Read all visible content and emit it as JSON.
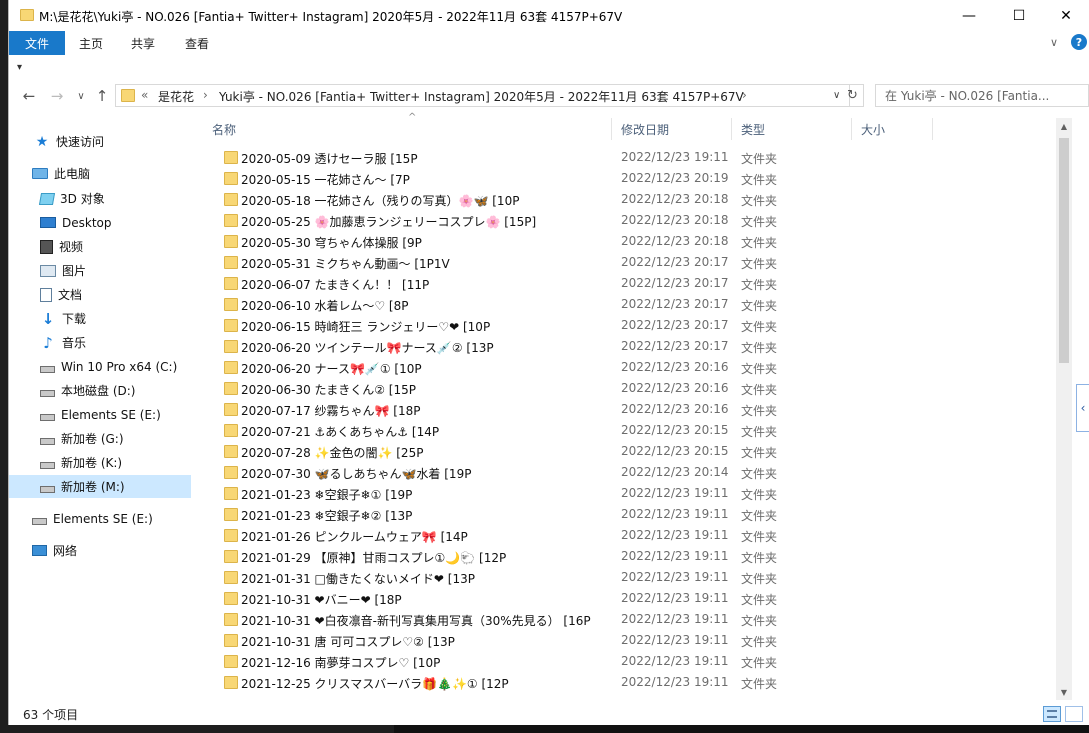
{
  "window": {
    "title": "M:\\是花花\\Yuki亭 - NO.026 [Fantia+ Twitter+ Instagram]  2020年5月 - 2022年11月 63套  4157P+67V",
    "minimize": "—",
    "maximize": "☐",
    "close": "✕"
  },
  "ribbon": {
    "file": "文件",
    "tabs": [
      "主页",
      "共享",
      "查看"
    ],
    "expand": "∨",
    "help": "?"
  },
  "qat": {
    "dropdown": "▾"
  },
  "nav": {
    "back": "←",
    "forward": "→",
    "recent": "∨",
    "up": "↑"
  },
  "address": {
    "chevron": "«",
    "segments": [
      "是花花",
      "Yuki亭 - NO.026 [Fantia+ Twitter+ Instagram]  2020年5月 - 2022年11月 63套  4157P+67V"
    ],
    "separator": "›",
    "dropdown": "∨",
    "refresh": "↻"
  },
  "search": {
    "placeholder": "在 Yuki亭 - NO.026 [Fantia..."
  },
  "sidebar": {
    "items": [
      {
        "label": "快速访问",
        "icon": "star-icon"
      },
      {
        "label": "此电脑",
        "icon": "computer-icon"
      },
      {
        "label": "3D 对象",
        "icon": "3d-objects-icon"
      },
      {
        "label": "Desktop",
        "icon": "desktop-icon"
      },
      {
        "label": "视频",
        "icon": "video-icon"
      },
      {
        "label": "图片",
        "icon": "pictures-icon"
      },
      {
        "label": "文档",
        "icon": "documents-icon"
      },
      {
        "label": "下载",
        "icon": "download-icon"
      },
      {
        "label": "音乐",
        "icon": "music-icon"
      },
      {
        "label": "Win 10 Pro x64 (C:)",
        "icon": "drive-icon"
      },
      {
        "label": "本地磁盘 (D:)",
        "icon": "drive-icon"
      },
      {
        "label": "Elements SE (E:)",
        "icon": "drive-icon"
      },
      {
        "label": "新加卷 (G:)",
        "icon": "drive-icon"
      },
      {
        "label": "新加卷 (K:)",
        "icon": "drive-icon"
      },
      {
        "label": "新加卷 (M:)",
        "icon": "drive-icon"
      },
      {
        "label": "Elements SE (E:)",
        "icon": "drive-icon"
      },
      {
        "label": "网络",
        "icon": "network-icon"
      }
    ]
  },
  "columns": {
    "name": "名称",
    "date": "修改日期",
    "type": "类型",
    "size": "大小",
    "sort": "^"
  },
  "files": [
    {
      "name": "2020-05-09 透けセーラ服 [15P",
      "date": "2022/12/23 19:11",
      "type": "文件夹"
    },
    {
      "name": "2020-05-15 一花姉さん～ [7P",
      "date": "2022/12/23 20:19",
      "type": "文件夹"
    },
    {
      "name": "2020-05-18 一花姉さん（残りの写真）🌸🦋 [10P",
      "date": "2022/12/23 20:18",
      "type": "文件夹"
    },
    {
      "name": "2020-05-25 🌸加藤恵ランジェリーコスプレ🌸 [15P]",
      "date": "2022/12/23 20:18",
      "type": "文件夹"
    },
    {
      "name": "2020-05-30 穹ちゃん体操服 [9P",
      "date": "2022/12/23 20:18",
      "type": "文件夹"
    },
    {
      "name": "2020-05-31 ミクちゃん動画～ [1P1V",
      "date": "2022/12/23 20:17",
      "type": "文件夹"
    },
    {
      "name": "2020-06-07 たまきくん！！ [11P",
      "date": "2022/12/23 20:17",
      "type": "文件夹"
    },
    {
      "name": "2020-06-10 水着レム～♡ [8P",
      "date": "2022/12/23 20:17",
      "type": "文件夹"
    },
    {
      "name": "2020-06-15 時崎狂三 ランジェリー♡❤ [10P",
      "date": "2022/12/23 20:17",
      "type": "文件夹"
    },
    {
      "name": "2020-06-20 ツインテール🎀ナース💉② [13P",
      "date": "2022/12/23 20:17",
      "type": "文件夹"
    },
    {
      "name": "2020-06-20 ナース🎀💉① [10P",
      "date": "2022/12/23 20:16",
      "type": "文件夹"
    },
    {
      "name": "2020-06-30 たまきくん② [15P",
      "date": "2022/12/23 20:16",
      "type": "文件夹"
    },
    {
      "name": "2020-07-17 纱霧ちゃん🎀 [18P",
      "date": "2022/12/23 20:16",
      "type": "文件夹"
    },
    {
      "name": "2020-07-21 ⚓あくあちゃん⚓ [14P",
      "date": "2022/12/23 20:15",
      "type": "文件夹"
    },
    {
      "name": "2020-07-28 ✨金色の闇✨ [25P",
      "date": "2022/12/23 20:15",
      "type": "文件夹"
    },
    {
      "name": "2020-07-30 🦋るしあちゃん🦋水着 [19P",
      "date": "2022/12/23 20:14",
      "type": "文件夹"
    },
    {
      "name": "2021-01-23 ❄空銀子❄① [19P",
      "date": "2022/12/23 19:11",
      "type": "文件夹"
    },
    {
      "name": "2021-01-23 ❄空銀子❄② [13P",
      "date": "2022/12/23 19:11",
      "type": "文件夹"
    },
    {
      "name": "2021-01-26 ピンクルームウェア🎀 [14P",
      "date": "2022/12/23 19:11",
      "type": "文件夹"
    },
    {
      "name": "2021-01-29 【原神】甘雨コスプレ①🌙🐑 [12P",
      "date": "2022/12/23 19:11",
      "type": "文件夹"
    },
    {
      "name": "2021-01-31 □働きたくないメイド❤ [13P",
      "date": "2022/12/23 19:11",
      "type": "文件夹"
    },
    {
      "name": "2021-10-31 ❤バニー❤ [18P",
      "date": "2022/12/23 19:11",
      "type": "文件夹"
    },
    {
      "name": "2021-10-31 ❤白夜凛音-新刊写真集用写真（30%先見る） [16P",
      "date": "2022/12/23 19:11",
      "type": "文件夹"
    },
    {
      "name": "2021-10-31 唐 可可コスプレ♡② [13P",
      "date": "2022/12/23 19:11",
      "type": "文件夹"
    },
    {
      "name": "2021-12-16 南夢芽コスプレ♡ [10P",
      "date": "2022/12/23 19:11",
      "type": "文件夹"
    },
    {
      "name": "2021-12-25 クリスマスバーバラ🎁🎄✨① [12P",
      "date": "2022/12/23 19:11",
      "type": "文件夹"
    }
  ],
  "scroll": {
    "up": "▲",
    "down": "▼"
  },
  "side_tab": "‹",
  "status": {
    "count": "63 个项目"
  }
}
